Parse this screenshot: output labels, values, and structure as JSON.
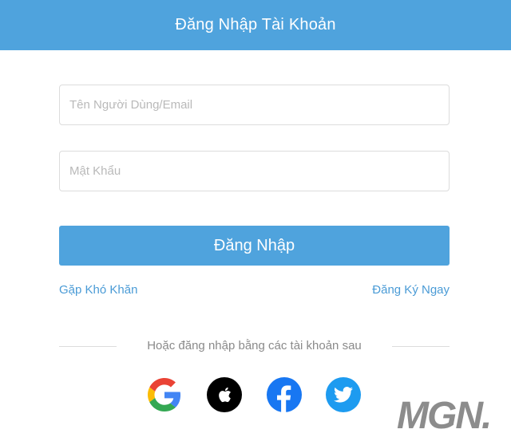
{
  "header": {
    "title": "Đăng Nhập Tài Khoản"
  },
  "form": {
    "username_placeholder": "Tên Người Dùng/Email",
    "password_placeholder": "Mật Khẩu",
    "username_value": "",
    "password_value": "",
    "submit_label": "Đăng Nhập"
  },
  "links": {
    "help": "Gặp Khó Khăn",
    "register": "Đăng Ký Ngay"
  },
  "divider": {
    "text": "Hoặc đăng nhập bằng các tài khoản sau"
  },
  "social": [
    {
      "icon": "google-icon"
    },
    {
      "icon": "apple-icon"
    },
    {
      "icon": "facebook-icon"
    },
    {
      "icon": "twitter-icon"
    }
  ],
  "colors": {
    "accent": "#4fa3dd",
    "link": "#4a9bd6",
    "facebook": "#1877f2",
    "twitter": "#1d9bf0"
  },
  "watermark": {
    "text": "MGN."
  }
}
